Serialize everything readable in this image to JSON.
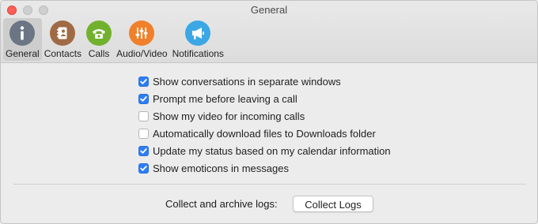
{
  "window": {
    "title": "General"
  },
  "tabs": [
    {
      "label": "General",
      "icon": "info-icon",
      "color": "#6b7583",
      "selected": true
    },
    {
      "label": "Contacts",
      "icon": "address-book-icon",
      "color": "#a06a45",
      "selected": false
    },
    {
      "label": "Calls",
      "icon": "phone-icon",
      "color": "#72b12e",
      "selected": false
    },
    {
      "label": "Audio/Video",
      "icon": "sliders-icon",
      "color": "#f0802a",
      "selected": false
    },
    {
      "label": "Notifications",
      "icon": "megaphone-icon",
      "color": "#3ba7e5",
      "selected": false
    }
  ],
  "options": [
    {
      "label": "Show conversations in separate windows",
      "checked": true
    },
    {
      "label": "Prompt me before leaving a call",
      "checked": true
    },
    {
      "label": "Show my video for incoming calls",
      "checked": false
    },
    {
      "label": "Automatically download files to Downloads folder",
      "checked": false
    },
    {
      "label": "Update my status based on my calendar information",
      "checked": true
    },
    {
      "label": "Show emoticons in messages",
      "checked": true
    }
  ],
  "logs": {
    "label": "Collect and archive logs:",
    "button_label": "Collect Logs"
  },
  "colors": {
    "accent": "#2d7df6",
    "close": "#fe5f57"
  }
}
